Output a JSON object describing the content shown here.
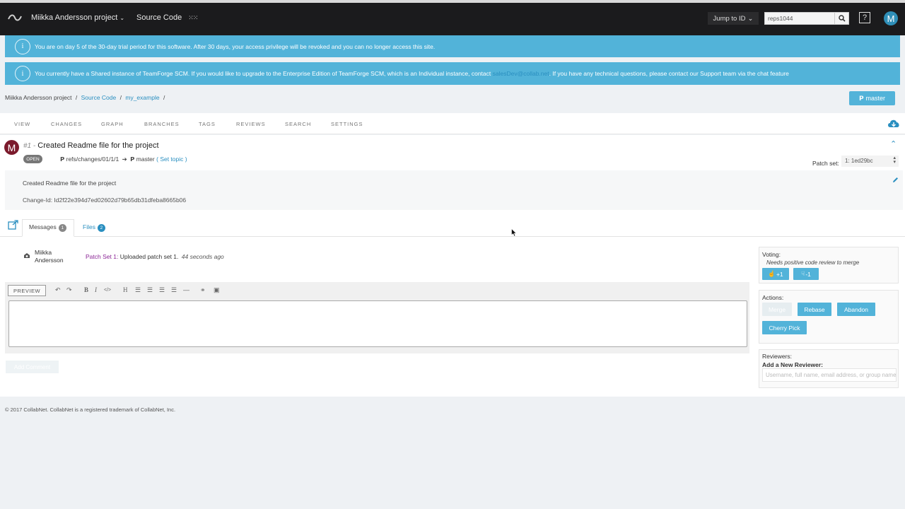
{
  "topbar": {
    "project": "Miikka Andersson project",
    "source_code": "Source Code",
    "jump_to_id": "Jump to ID",
    "search_value": "reps1044",
    "help": "?",
    "user_initial": "M"
  },
  "banners": {
    "trial": "You are on day 5 of the 30-day trial period for this software. After 30 days, your access privilege will be revoked and you can no longer access this site.",
    "shared_pre": "You currently have a Shared instance of TeamForge SCM. If you would like to upgrade to the Enterprise Edition of TeamForge SCM, which is an Individual instance, contact",
    "shared_link": "salesDev@collab.net",
    "shared_post": ". If you have any technical questions, please contact our Support team via the chat feature"
  },
  "breadcrumb": {
    "project": "Miikka Andersson project",
    "sep": "/",
    "source_code": "Source Code",
    "repo": "my_example",
    "branch_button": "master"
  },
  "tabs": [
    "VIEW",
    "CHANGES",
    "GRAPH",
    "BRANCHES",
    "TAGS",
    "REVIEWS",
    "SEARCH",
    "SETTINGS"
  ],
  "change": {
    "number": "#1 -",
    "title": "Created Readme file for the project",
    "status": "OPEN",
    "ref": "refs/changes/01/1/1",
    "target": "master",
    "set_topic": "( Set topic )",
    "patch_set_label": "Patch set:",
    "patch_set_value": "1: 1ed29bc",
    "description": "Created Readme file for the project",
    "change_id": "Change-Id: Id2f22e394d7ed02602d79b65db31dfeba8665b06"
  },
  "subtabs": {
    "messages": "Messages",
    "messages_count": "1",
    "files": "Files",
    "files_count": "2"
  },
  "message": {
    "author_first": "Miikka",
    "author_last": "Andersson",
    "patch_label": "Patch Set 1:",
    "text": "Uploaded patch set 1.",
    "time": "44 seconds ago"
  },
  "editor": {
    "preview": "PREVIEW",
    "add_comment": "Add Comment"
  },
  "voting": {
    "title": "Voting:",
    "note": "Needs positive code review to merge",
    "plus": "+1",
    "minus": "-1"
  },
  "actions": {
    "title": "Actions:",
    "merge": "Merge",
    "rebase": "Rebase",
    "abandon": "Abandon",
    "cherry_pick": "Cherry Pick"
  },
  "reviewers": {
    "title": "Reviewers:",
    "add_label": "Add a New Reviewer:",
    "placeholder": "Username, full name, email address, or group name"
  },
  "footer": "© 2017 CollabNet. CollabNet is a registered trademark of CollabNet, Inc.",
  "colors": {
    "accent": "#52b3d9",
    "topbar": "#1b1b1d",
    "avatar": "#7b1a2c",
    "patch": "#8b2596"
  }
}
